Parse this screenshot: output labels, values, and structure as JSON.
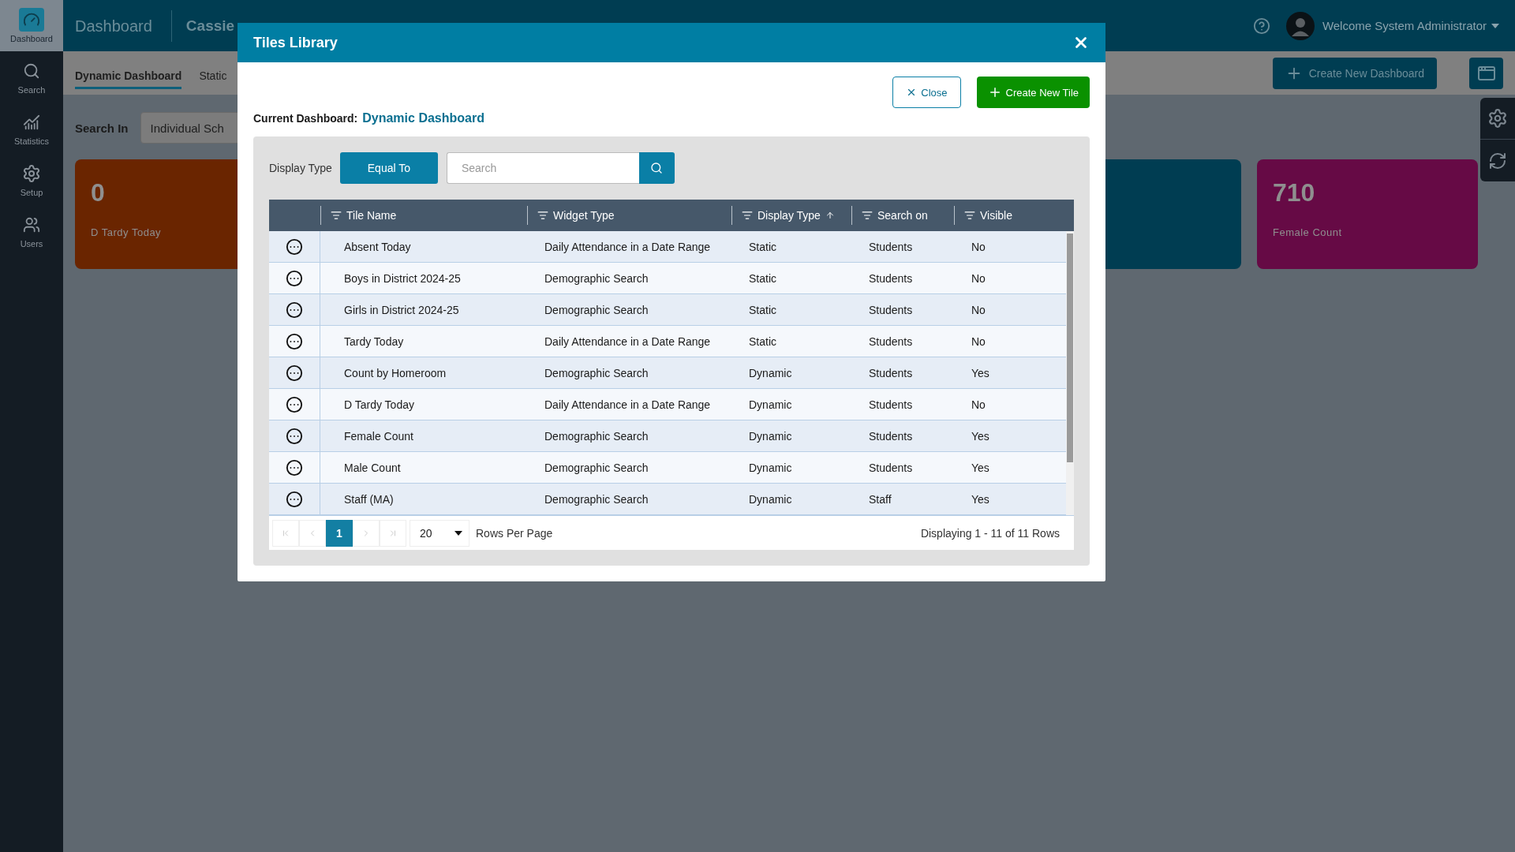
{
  "sidebar": {
    "items": [
      {
        "kind": "dashboard",
        "label": "Dashboard",
        "selected": true
      },
      {
        "kind": "search",
        "label": "Search",
        "selected": false
      },
      {
        "kind": "statistics",
        "label": "Statistics",
        "selected": false
      },
      {
        "kind": "setup",
        "label": "Setup",
        "selected": false
      },
      {
        "kind": "users",
        "label": "Users",
        "selected": false
      }
    ]
  },
  "header": {
    "title": "Dashboard",
    "subtitle": "Cassie",
    "user": "Welcome System Administrator"
  },
  "tabs": [
    {
      "label": "Dynamic Dashboard",
      "selected": true
    },
    {
      "label": "Static",
      "selected": false
    }
  ],
  "toolbar": {
    "search_in_label": "Search In",
    "search_in_value": "Individual Sch",
    "create_button": "Create New Dashboard"
  },
  "tiles": [
    {
      "value": "0",
      "label": "D Tardy Today",
      "color": "#6a2500"
    },
    {
      "color": "#003d52"
    },
    {
      "value": "710",
      "label": "Female Count",
      "color": "#660a45"
    }
  ],
  "modal": {
    "title": "Tiles Library",
    "close_button": "Close",
    "create_button": "Create New Tile",
    "current_label": "Current Dashboard:",
    "current_value": "Dynamic Dashboard",
    "filter_label": "Display Type",
    "filter_button": "Equal To",
    "search_placeholder": "Search",
    "table": {
      "columns": [
        {
          "label": "Tile Name",
          "sorted": false
        },
        {
          "label": "Widget Type",
          "sorted": false
        },
        {
          "label": "Display Type",
          "sorted": true
        },
        {
          "label": "Search on",
          "sorted": false
        },
        {
          "label": "Visible",
          "sorted": false
        }
      ],
      "rows": [
        [
          "Absent Today",
          "Daily Attendance in a Date Range",
          "Static",
          "Students",
          "No"
        ],
        [
          "Boys in District 2024-25",
          "Demographic Search",
          "Static",
          "Students",
          "No"
        ],
        [
          "Girls in District 2024-25",
          "Demographic Search",
          "Static",
          "Students",
          "No"
        ],
        [
          "Tardy Today",
          "Daily Attendance in a Date Range",
          "Static",
          "Students",
          "No"
        ],
        [
          "Count by Homeroom",
          "Demographic Search",
          "Dynamic",
          "Students",
          "Yes"
        ],
        [
          "D Tardy Today",
          "Daily Attendance in a Date Range",
          "Dynamic",
          "Students",
          "No"
        ],
        [
          "Female Count",
          "Demographic Search",
          "Dynamic",
          "Students",
          "Yes"
        ],
        [
          "Male Count",
          "Demographic Search",
          "Dynamic",
          "Students",
          "Yes"
        ],
        [
          "Staff (MA)",
          "Demographic Search",
          "Dynamic",
          "Staff",
          "Yes"
        ]
      ]
    },
    "pagination": {
      "pages": [
        {
          "label": "1",
          "selected": true
        }
      ],
      "page_size": "20",
      "page_size_label": "Rows Per Page",
      "summary": "Displaying 1 - 11 of 11 Rows"
    }
  }
}
